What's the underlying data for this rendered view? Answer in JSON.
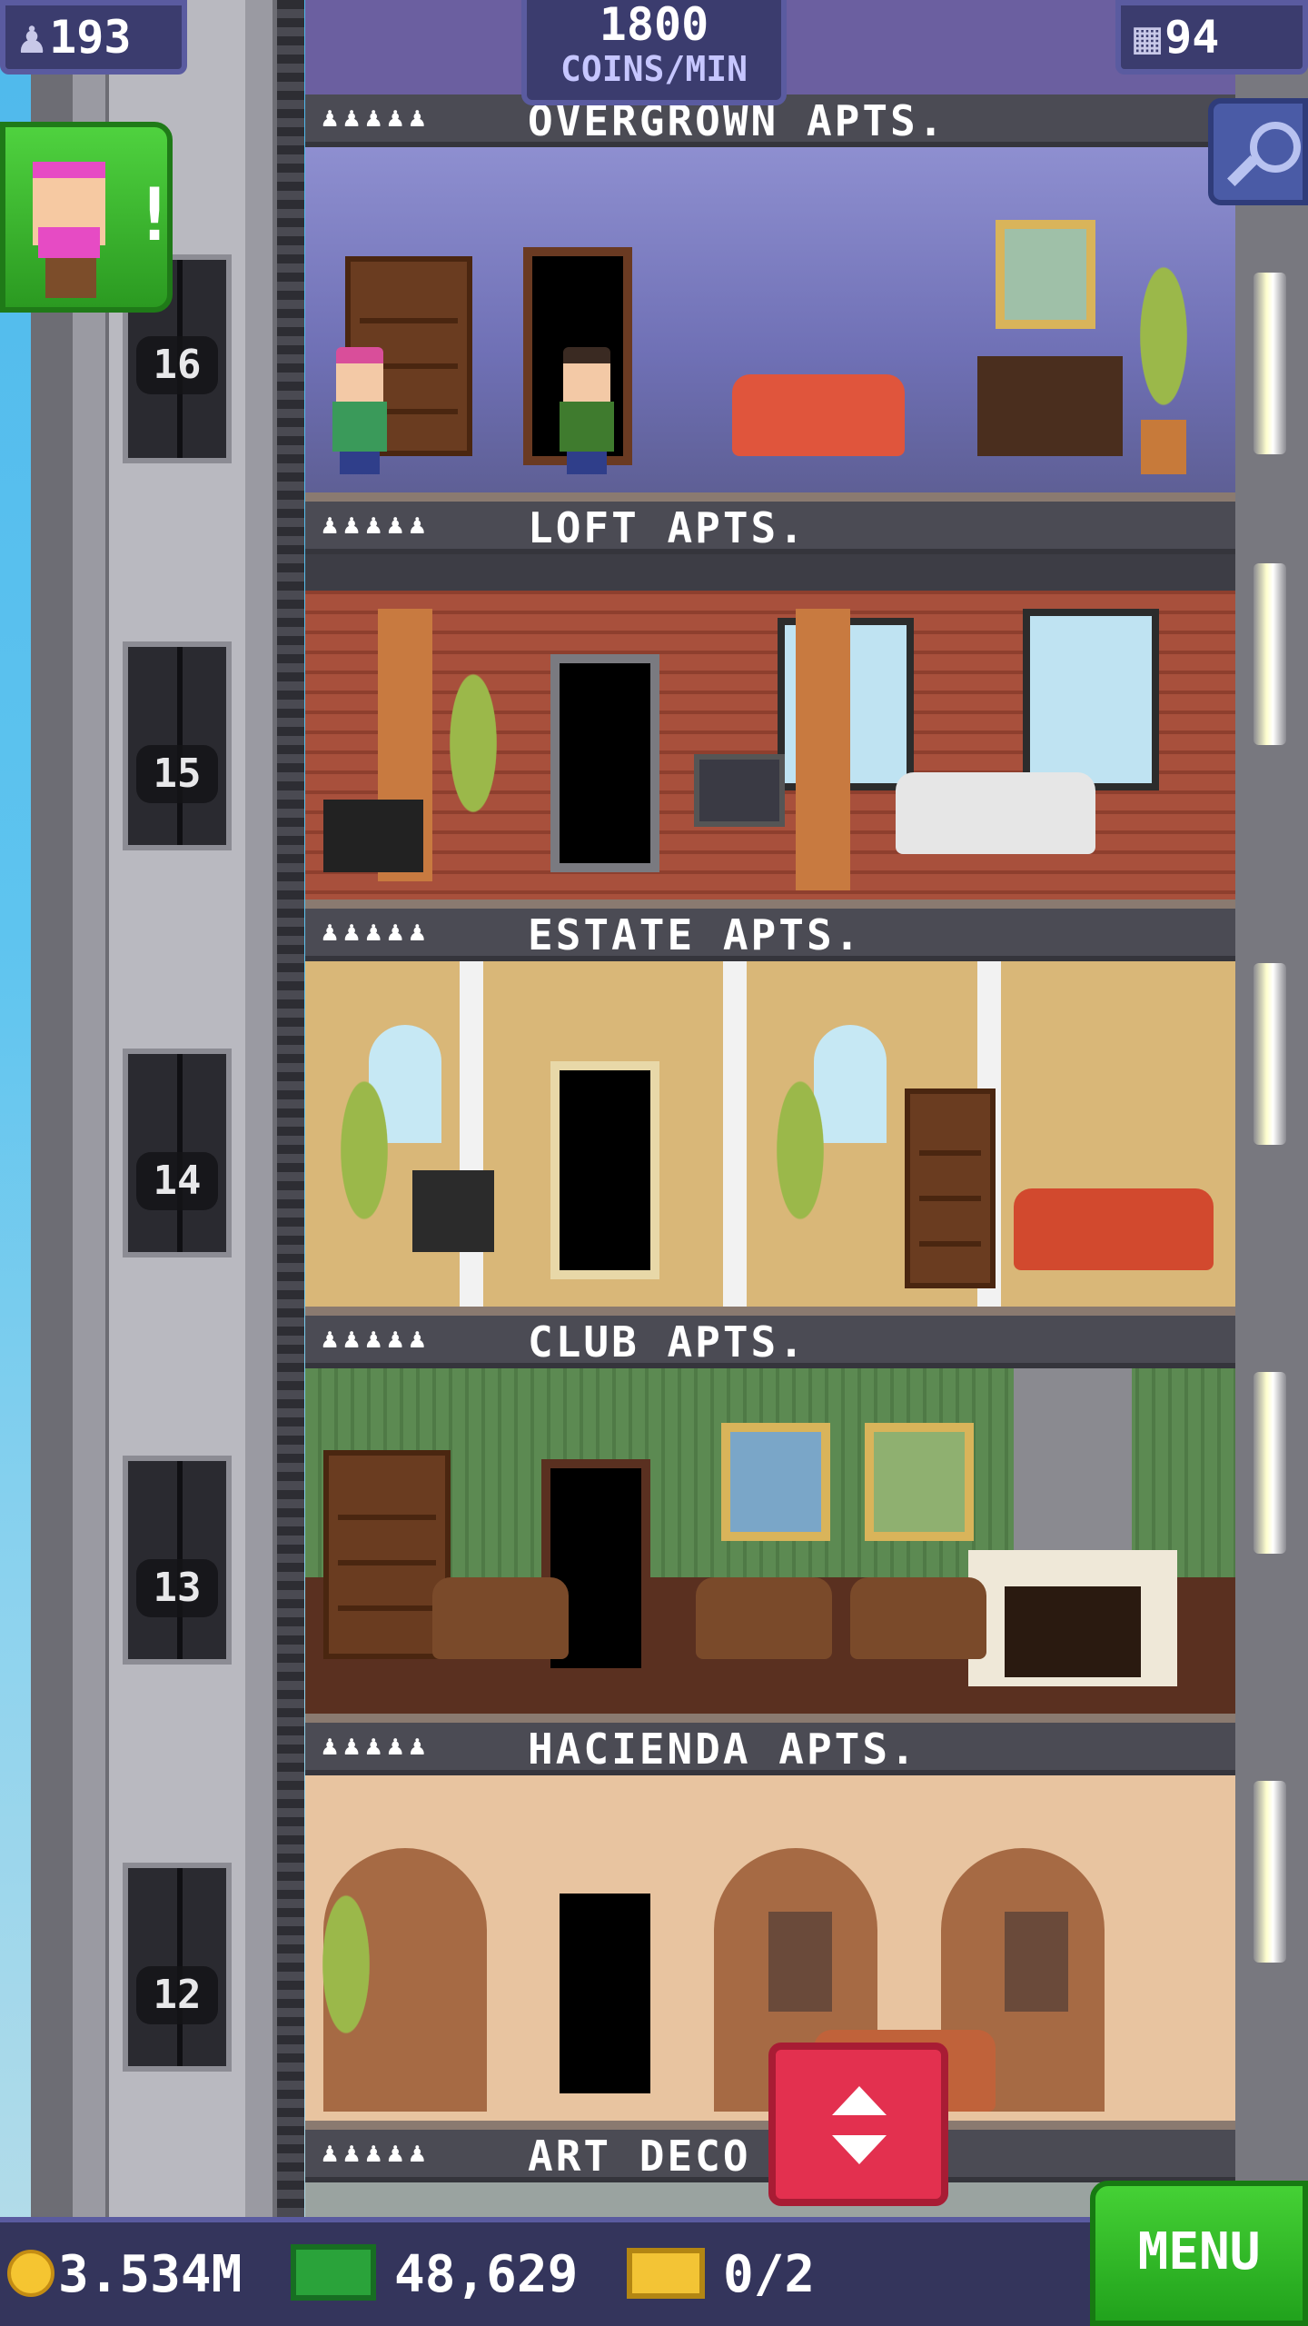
{
  "hud": {
    "population": "193",
    "coin_rate_value": "1800",
    "coin_rate_unit": "COINS/MIN",
    "floors_count": "94"
  },
  "floors": [
    {
      "name": "OVERGROWN APTS.",
      "stars": "♟♟♟♟♟",
      "number": "16"
    },
    {
      "name": "LOFT APTS.",
      "stars": "♟♟♟♟♟",
      "number": "15"
    },
    {
      "name": "ESTATE APTS.",
      "stars": "♟♟♟♟♟",
      "number": "14"
    },
    {
      "name": "CLUB APTS.",
      "stars": "♟♟♟♟♟",
      "number": "13"
    },
    {
      "name": "HACIENDA APTS.",
      "stars": "♟♟♟♟♟",
      "number": "12"
    },
    {
      "name": "ART DECO",
      "stars": "♟♟♟♟♟"
    }
  ],
  "alert": {
    "mark": "!"
  },
  "bottom": {
    "coins": "3.534M",
    "bux": "48,629",
    "tickets": "0/2",
    "menu_label": "MENU"
  },
  "colors": {
    "hud_bg": "#3b3c6e",
    "menu_green": "#2eb625",
    "elevator_button_red": "#e3304f"
  },
  "icons": [
    "population-icon",
    "floors-icon",
    "search-icon",
    "coin-icon",
    "bux-icon",
    "ticket-icon",
    "elevator-updown-icon"
  ]
}
